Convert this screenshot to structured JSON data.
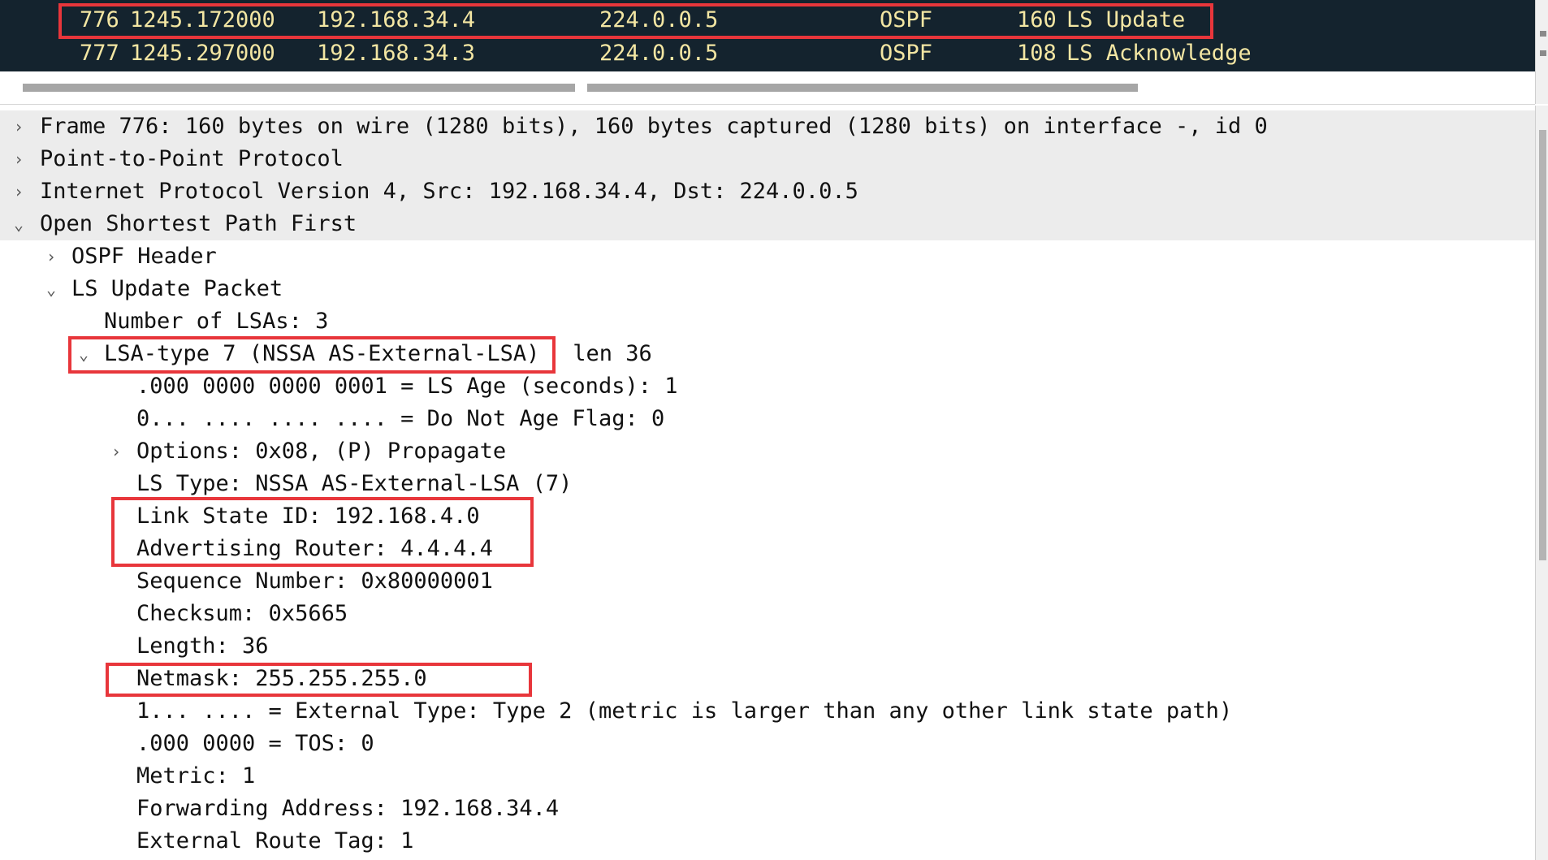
{
  "packet_list": {
    "rows": [
      {
        "no": "776",
        "time": "1245.172000",
        "source": "192.168.34.4",
        "destination": "224.0.0.5",
        "protocol": "OSPF",
        "length": "160",
        "info": "LS Update"
      },
      {
        "no": "777",
        "time": "1245.297000",
        "source": "192.168.34.3",
        "destination": "224.0.0.5",
        "protocol": "OSPF",
        "length": "108",
        "info": "LS Acknowledge"
      }
    ]
  },
  "details": {
    "frame": "Frame 776: 160 bytes on wire (1280 bits), 160 bytes captured (1280 bits) on interface -, id 0",
    "ppp": "Point-to-Point Protocol",
    "ipv4": "Internet Protocol Version 4, Src: 192.168.34.4, Dst: 224.0.0.5",
    "ospf": "Open Shortest Path First",
    "ospf_header": "OSPF Header",
    "ls_update_packet": "LS Update Packet",
    "number_of_lsas": "Number of LSAs: 3",
    "lsa_title": "LSA-type 7 (NSSA AS-External-LSA)",
    "lsa_len": " len 36",
    "ls_age": ".000 0000 0000 0001 = LS Age (seconds): 1",
    "do_not_age": "0... .... .... .... = Do Not Age Flag: 0",
    "options": "Options: 0x08, (P) Propagate",
    "ls_type": "LS Type: NSSA AS-External-LSA (7)",
    "link_state_id": "Link State ID: 192.168.4.0",
    "advertising_router": "Advertising Router: 4.4.4.4",
    "sequence_number": "Sequence Number: 0x80000001",
    "checksum": "Checksum: 0x5665",
    "length": "Length: 36",
    "netmask": "Netmask: 255.255.255.0",
    "external_type": "1... .... = External Type: Type 2 (metric is larger than any other link state path)",
    "tos": ".000 0000 = TOS: 0",
    "metric": "Metric: 1",
    "forwarding_address": "Forwarding Address: 192.168.34.4",
    "external_route_tag": "External Route Tag: 1"
  },
  "icons": {
    "collapsed": "›",
    "expanded": "⌄"
  },
  "colors": {
    "packet_list_bg": "#14232e",
    "packet_text": "#f3e6a3",
    "highlight": "#e8363b"
  }
}
